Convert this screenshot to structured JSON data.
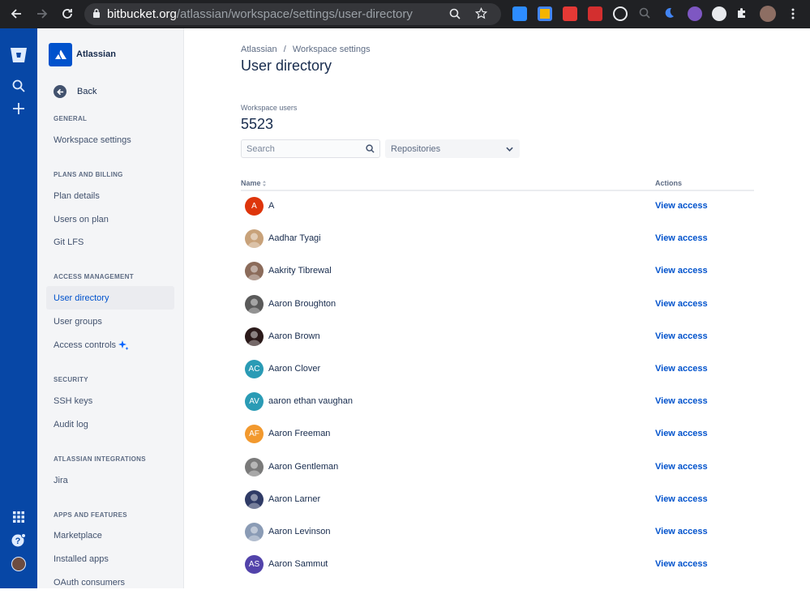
{
  "browser": {
    "url_host": "bitbucket.org",
    "url_path": "/atlassian/workspace/settings/user-directory"
  },
  "sidebar": {
    "workspace_name": "Atlassian",
    "back_label": "Back",
    "sections": [
      {
        "heading": "GENERAL",
        "items": [
          "Workspace settings"
        ]
      },
      {
        "heading": "PLANS AND BILLING",
        "items": [
          "Plan details",
          "Users on plan",
          "Git LFS"
        ]
      },
      {
        "heading": "ACCESS MANAGEMENT",
        "items": [
          "User directory",
          "User groups",
          "Access controls"
        ]
      },
      {
        "heading": "SECURITY",
        "items": [
          "SSH keys",
          "Audit log"
        ]
      },
      {
        "heading": "ATLASSIAN INTEGRATIONS",
        "items": [
          "Jira"
        ]
      },
      {
        "heading": "APPS AND FEATURES",
        "items": [
          "Marketplace",
          "Installed apps",
          "OAuth consumers"
        ]
      }
    ]
  },
  "main": {
    "breadcrumbs": [
      "Atlassian",
      "/",
      "Workspace settings"
    ],
    "title": "User directory",
    "workspace_users_label": "Workspace users",
    "workspace_users_count": "5523",
    "search_placeholder": "Search",
    "repositories_select": "Repositories",
    "col_name": "Name",
    "col_actions": "Actions",
    "users": [
      {
        "name": "A",
        "initials": "A",
        "color": "#DE350B",
        "photo": false
      },
      {
        "name": "Aadhar Tyagi",
        "initials": "",
        "color": "#C8A27A",
        "photo": true
      },
      {
        "name": "Aakrity Tibrewal",
        "initials": "",
        "color": "#8B6B5A",
        "photo": true
      },
      {
        "name": "Aaron Broughton",
        "initials": "",
        "color": "#5A5A5A",
        "photo": true
      },
      {
        "name": "Aaron Brown",
        "initials": "",
        "color": "#2B1A1A",
        "photo": true
      },
      {
        "name": "Aaron Clover",
        "initials": "AC",
        "color": "#2A9BB5",
        "photo": false
      },
      {
        "name": "aaron ethan vaughan",
        "initials": "AV",
        "color": "#2A9BB5",
        "photo": false
      },
      {
        "name": "Aaron Freeman",
        "initials": "AF",
        "color": "#F2992E",
        "photo": false
      },
      {
        "name": "Aaron Gentleman",
        "initials": "",
        "color": "#7A7A7A",
        "photo": true
      },
      {
        "name": "Aaron Larner",
        "initials": "",
        "color": "#2F3B66",
        "photo": true
      },
      {
        "name": "Aaron Levinson",
        "initials": "",
        "color": "#8A9BB5",
        "photo": true
      },
      {
        "name": "Aaron Sammut",
        "initials": "AS",
        "color": "#5243AA",
        "photo": false
      }
    ],
    "view_access_label": "View access"
  }
}
